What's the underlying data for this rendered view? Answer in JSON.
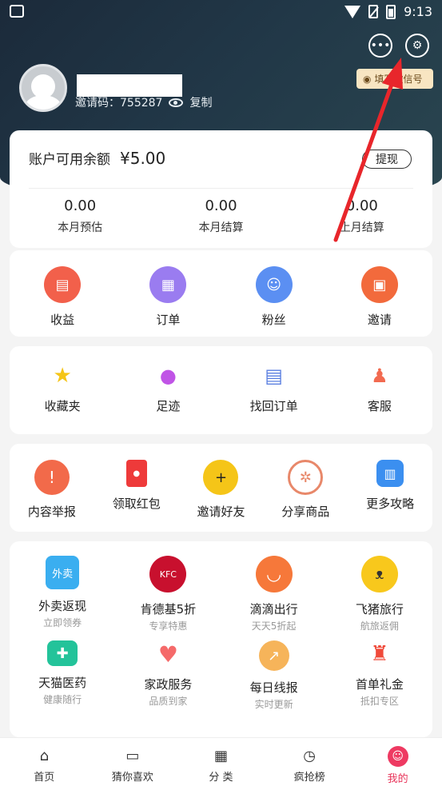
{
  "status_bar": {
    "time": "9:13"
  },
  "header": {
    "invite_label": "邀请码：755287",
    "copy_label": "复制",
    "wechat_badge": "填写微信号"
  },
  "balance": {
    "label": "账户可用余额",
    "value": "¥5.00",
    "withdraw_label": "提现",
    "stats": [
      {
        "value": "0.00",
        "label": "本月预估"
      },
      {
        "value": "0.00",
        "label": "本月结算"
      },
      {
        "value": "0.00",
        "label": "上月结算"
      }
    ]
  },
  "main_menu": [
    {
      "label": "收益",
      "icon": "income-icon",
      "color": "#f2604b"
    },
    {
      "label": "订单",
      "icon": "order-icon",
      "color": "#9a7cf0"
    },
    {
      "label": "粉丝",
      "icon": "fans-icon",
      "color": "#5b8ff2"
    },
    {
      "label": "邀请",
      "icon": "gift-icon",
      "color": "#f26a3c"
    }
  ],
  "tools": [
    {
      "label": "收藏夹",
      "icon": "star-icon",
      "color": "#f5c518"
    },
    {
      "label": "足迹",
      "icon": "footprint-icon",
      "color": "#c054e6"
    },
    {
      "label": "找回订单",
      "icon": "document-icon",
      "color": "#5b7fe0"
    },
    {
      "label": "客服",
      "icon": "service-icon",
      "color": "#f26a50"
    }
  ],
  "tools2": [
    {
      "label": "内容举报",
      "icon": "warning-icon",
      "color": "#f26a4a"
    },
    {
      "label": "领取红包",
      "icon": "red-envelope-icon",
      "color": "#ee3a3a"
    },
    {
      "label": "邀请好友",
      "icon": "add-friend-icon",
      "color": "#f5c518"
    },
    {
      "label": "分享商品",
      "icon": "share-aperture-icon",
      "color": "#e8886a"
    },
    {
      "label": "更多攻略",
      "icon": "book-icon",
      "color": "#3b8ff0"
    }
  ],
  "promos": [
    {
      "label": "外卖返现",
      "sub": "立即领券",
      "icon": "takeout-icon",
      "color": "#3aaef0"
    },
    {
      "label": "肯德基5折",
      "sub": "专享特惠",
      "icon": "kfc-icon",
      "color": "#c8102e"
    },
    {
      "label": "滴滴出行",
      "sub": "天天5折起",
      "icon": "didi-icon",
      "color": "#f6783a"
    },
    {
      "label": "飞猪旅行",
      "sub": "航旅返佣",
      "icon": "fliggy-icon",
      "color": "#f8c81c"
    },
    {
      "label": "天猫医药",
      "sub": "健康随行",
      "icon": "medical-icon",
      "color": "#23c39a"
    },
    {
      "label": "家政服务",
      "sub": "品质到家",
      "icon": "housekeeping-icon",
      "color": "#f56a6a"
    },
    {
      "label": "每日线报",
      "sub": "实时更新",
      "icon": "daily-report-icon",
      "color": "#f6b45a"
    },
    {
      "label": "首单礼金",
      "sub": "抵扣专区",
      "icon": "money-bag-icon",
      "color": "#f04a3a"
    }
  ],
  "tabs": [
    {
      "label": "首页",
      "icon": "home-icon"
    },
    {
      "label": "猜你喜欢",
      "icon": "like-icon"
    },
    {
      "label": "分 类",
      "icon": "category-icon"
    },
    {
      "label": "疯抢榜",
      "icon": "clock-icon"
    },
    {
      "label": "我的",
      "icon": "profile-icon",
      "active": true
    }
  ]
}
